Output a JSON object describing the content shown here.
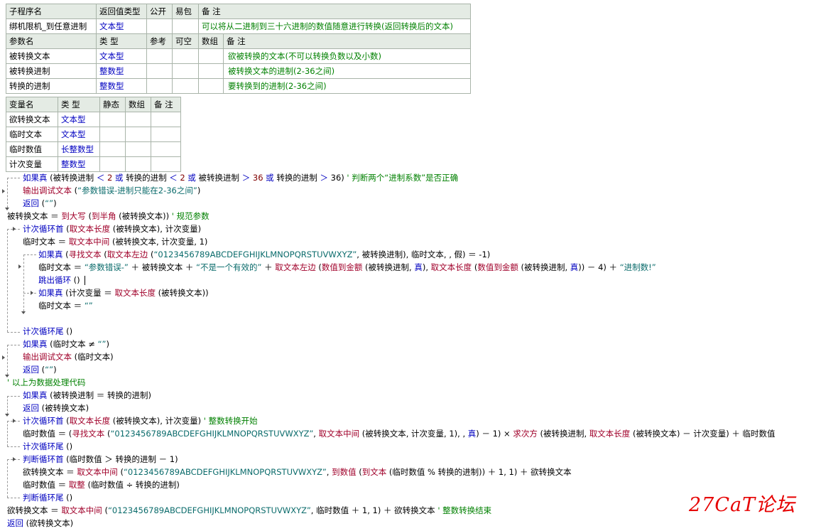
{
  "sub_table": {
    "headers": [
      "子程序名",
      "返回值类型",
      "公开",
      "易包",
      "备 注"
    ],
    "row": [
      "绑机限机_到任意进制",
      "文本型",
      "",
      "",
      "可以将从二进制到三十六进制的数值随意进行转换(返回转换后的文本)"
    ]
  },
  "param_table": {
    "headers": [
      "参数名",
      "类 型",
      "参考",
      "可空",
      "数组",
      "备 注"
    ],
    "rows": [
      [
        "被转换文本",
        "文本型",
        "",
        "",
        "",
        "欲被转换的文本(不可以转换负数以及小数)"
      ],
      [
        "被转换进制",
        "整数型",
        "",
        "",
        "",
        "被转换文本的进制(2-36之间)"
      ],
      [
        "转换的进制",
        "整数型",
        "",
        "",
        "",
        "要转换到的进制(2-36之间)"
      ]
    ]
  },
  "var_table": {
    "headers": [
      "变量名",
      "类 型",
      "静态",
      "数组",
      "备 注"
    ],
    "rows": [
      [
        "欲转换文本",
        "文本型",
        "",
        "",
        ""
      ],
      [
        "临时文本",
        "文本型",
        "",
        "",
        ""
      ],
      [
        "临时数值",
        "长整数型",
        "",
        "",
        ""
      ],
      [
        "计次变量",
        "整数型",
        "",
        "",
        ""
      ]
    ]
  },
  "code": {
    "l1": {
      "a": "如果真",
      "b": " (被转换进制 ",
      "c": "＜",
      "d": " 2 ",
      "e": "或",
      "f": " 转换的进制 ",
      "g": "＜",
      "h": " 2 ",
      "i": "或",
      "j": " 被转换进制 ",
      "k": "＞",
      "l": " 36 ",
      "m": "或",
      "n": " 转换的进制 ",
      "o": "＞",
      "p": " 36) ",
      "q": " ' 判断两个“进制系数”是否正确"
    },
    "l2": {
      "a": "输出调试文本",
      "b": " (",
      "c": "“参数错误-进制只能在2-36之间”",
      "d": ")"
    },
    "l3": {
      "a": "返回",
      "b": " (",
      "c": "“”",
      "d": ")"
    },
    "l4": {
      "a": "被转换文本 ＝ ",
      "b": "到大写",
      "c": " (",
      "d": "到半角",
      "e": " (被转换文本)) ",
      "f": " ' 规范参数"
    },
    "l5": {
      "a": "计次循环首",
      "b": " (",
      "c": "取文本长度",
      "d": " (被转换文本), 计次变量)"
    },
    "l6": {
      "a": "临时文本 ＝ ",
      "b": "取文本中间",
      "c": " (被转换文本, 计次变量, 1)"
    },
    "l7": {
      "a": "如果真",
      "b": " (",
      "c": "寻找文本",
      "d": " (",
      "e": "取文本左边",
      "f": " (",
      "g": "“0123456789ABCDEFGHIJKLMNOPQRSTUVWXYZ”",
      "h": ", 被转换进制), 临时文本, , 假) ＝ -1)"
    },
    "l8": {
      "a": "临时文本 ＝ ",
      "b": "“参数错误-”",
      "c": " ＋ 被转换文本 ＋ ",
      "d": "“不是一个有效的”",
      "e": " ＋ ",
      "f": "取文本左边",
      "g": " (",
      "h": "数值到金额",
      "i": " (被转换进制, ",
      "j": "真",
      "k": "), ",
      "l": "取文本长度",
      "m": " (",
      "n": "数值到金额",
      "o": " (被转换进制, ",
      "p": "真",
      "q": ")) － 4) ＋ ",
      "r": "“进制数!”"
    },
    "l9": {
      "a": "跳出循环",
      "b": " ()"
    },
    "l10": {
      "a": "如果真",
      "b": " (计次变量 ＝ ",
      "c": "取文本长度",
      "d": " (被转换文本))"
    },
    "l11": {
      "a": "临时文本 ＝ ",
      "b": "“”"
    },
    "l12": {
      "a": "计次循环尾",
      "b": " ()"
    },
    "l13": {
      "a": "如果真",
      "b": " (临时文本 ≠ ",
      "c": "“”",
      "d": ")"
    },
    "l14": {
      "a": "输出调试文本",
      "b": " (临时文本)"
    },
    "l15": {
      "a": "返回",
      "b": " (",
      "c": "“”",
      "d": ")"
    },
    "l16": {
      "a": " ' 以上为数据处理代码"
    },
    "l17": {
      "a": "如果真",
      "b": " (被转换进制 ＝ 转换的进制)"
    },
    "l18": {
      "a": "返回",
      "b": " (被转换文本)"
    },
    "l19": {
      "a": "计次循环首",
      "b": " (",
      "c": "取文本长度",
      "d": " (被转换文本), 计次变量) ",
      "e": " ' 整数转换开始"
    },
    "l20": {
      "a": "临时数值 ＝ (",
      "b": "寻找文本",
      "c": " (",
      "d": "“0123456789ABCDEFGHIJKLMNOPQRSTUVWXYZ”",
      "e": ", ",
      "f": "取文本中间",
      "g": " (被转换文本, 计次变量, 1), , ",
      "h": "真",
      "i": ") － 1) × ",
      "j": "求次方",
      "k": " (被转换进制, ",
      "l": "取文本长度",
      "m": " (被转换文本) － 计次变量) ＋ 临时数值"
    },
    "l21": {
      "a": "计次循环尾",
      "b": " ()"
    },
    "l22": {
      "a": "判断循环首",
      "b": " (临时数值 ＞ 转换的进制 － 1)"
    },
    "l23": {
      "a": "欲转换文本 ＝ ",
      "b": "取文本中间",
      "c": " (",
      "d": "“0123456789ABCDEFGHIJKLMNOPQRSTUVWXYZ”",
      "e": ", ",
      "f": "到数值",
      "g": " (",
      "h": "到文本",
      "i": " (临时数值 % 转换的进制)) ＋ 1, 1) ＋ 欲转换文本"
    },
    "l24": {
      "a": "临时数值 ＝ ",
      "b": "取整",
      "c": " (临时数值 ÷ 转换的进制)"
    },
    "l25": {
      "a": "判断循环尾",
      "b": " ()"
    },
    "l26": {
      "a": "欲转换文本 ＝ ",
      "b": "取文本中间",
      "c": " (",
      "d": "“0123456789ABCDEFGHIJKLMNOPQRSTUVWXYZ”",
      "e": ", 临时数值 ＋ 1, 1) ＋ 欲转换文本 ",
      "f": " ' 整数转换结束"
    },
    "l27": {
      "a": "返回",
      "b": " (欲转换文本)"
    }
  },
  "watermark": "27CaT论坛",
  "colors": {
    "keyword": "#0000c0",
    "function": "#a0002a",
    "string": "#0a6b6b",
    "comment": "#008000",
    "header_bg": "#e4ebe4"
  }
}
